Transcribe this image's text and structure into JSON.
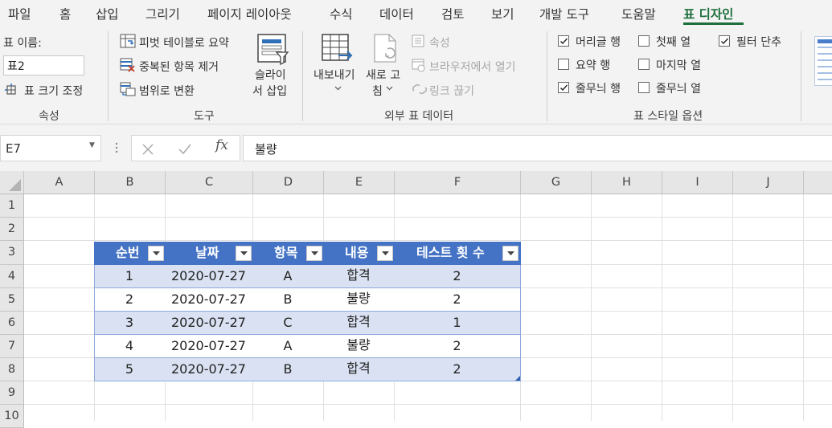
{
  "menu": {
    "tabs": [
      "파일",
      "홈",
      "삽입",
      "그리기",
      "페이지 레이아웃",
      "수식",
      "데이터",
      "검토",
      "보기",
      "개발 도구",
      "도움말",
      "표 디자인"
    ],
    "active_index": 11
  },
  "ribbon": {
    "properties": {
      "table_name_label": "표 이름:",
      "table_name_value": "표2",
      "resize_table": "표 크기 조정",
      "group_label": "속성"
    },
    "tools": {
      "pivot_summary": "피벗 테이블로 요약",
      "remove_duplicates": "중복된 항목 제거",
      "convert_to_range": "범위로 변환",
      "slicer_line1": "슬라이",
      "slicer_line2": "서 삽입",
      "group_label": "도구"
    },
    "external": {
      "export_label": "내보내기",
      "refresh_line1": "새로 고",
      "refresh_line2": "침",
      "properties": "속성",
      "open_in_browser": "브라우저에서 열기",
      "unlink": "링크 끊기",
      "group_label": "외부 표 데이터"
    },
    "style_options": {
      "items": [
        {
          "label": "머리글 행",
          "checked": true
        },
        {
          "label": "요약 행",
          "checked": false
        },
        {
          "label": "줄무늬 행",
          "checked": true
        },
        {
          "label": "첫째 열",
          "checked": false
        },
        {
          "label": "마지막 열",
          "checked": false
        },
        {
          "label": "줄무늬 열",
          "checked": false
        },
        {
          "label": "필터 단추",
          "checked": true
        }
      ],
      "group_label": "표 스타일 옵션"
    }
  },
  "formula_bar": {
    "cell_ref": "E7",
    "formula": "불량",
    "fx_label": "fx"
  },
  "sheet": {
    "columns": [
      "A",
      "B",
      "C",
      "D",
      "E",
      "F",
      "G",
      "H",
      "I",
      "J"
    ],
    "rows": [
      "1",
      "2",
      "3",
      "4",
      "5",
      "6",
      "7",
      "8",
      "9",
      "10"
    ],
    "table": {
      "headers": [
        "순번",
        "날짜",
        "항목",
        "내용",
        "테스트 횟 수"
      ],
      "rows": [
        [
          "1",
          "2020-07-27",
          "A",
          "합격",
          "2"
        ],
        [
          "2",
          "2020-07-27",
          "B",
          "불량",
          "2"
        ],
        [
          "3",
          "2020-07-27",
          "C",
          "합격",
          "1"
        ],
        [
          "4",
          "2020-07-27",
          "A",
          "불량",
          "2"
        ],
        [
          "5",
          "2020-07-27",
          "B",
          "합격",
          "2"
        ]
      ],
      "header_color": "#4472c4",
      "band_color": "#d9e1f2"
    }
  }
}
